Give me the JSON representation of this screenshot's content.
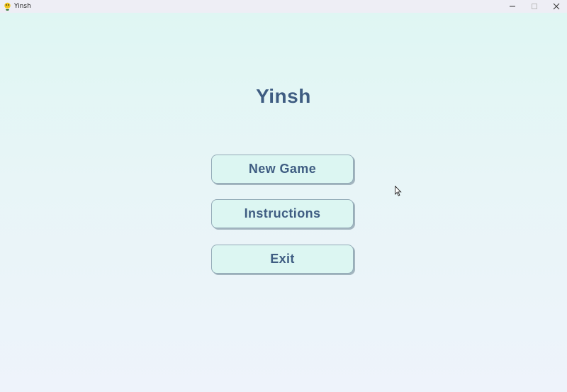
{
  "window": {
    "title": "Yinsh",
    "app_icon": "pygame-snake-icon",
    "controls": [
      "minimize-icon",
      "maximize-icon",
      "close-icon"
    ]
  },
  "game": {
    "title": "Yinsh"
  },
  "menu": {
    "buttons": [
      {
        "label": "New Game"
      },
      {
        "label": "Instructions"
      },
      {
        "label": "Exit"
      }
    ]
  },
  "colors": {
    "title_text": "#3f5d82",
    "button_fill": "#dcf6f2",
    "button_border": "#93abb7",
    "background_top": "#dff6f3",
    "background_bottom": "#eef3fb"
  }
}
